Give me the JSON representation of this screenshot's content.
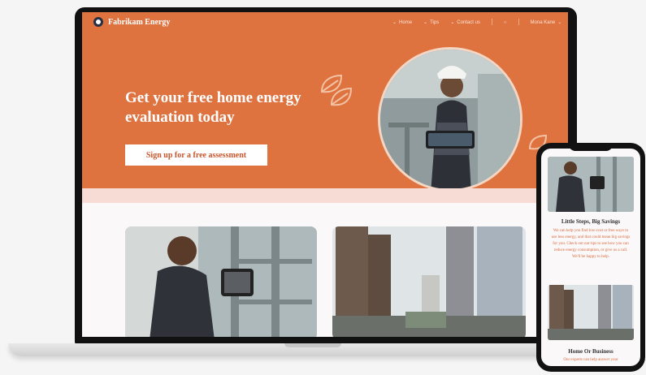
{
  "brand": {
    "name": "Fabrikam Energy"
  },
  "nav": {
    "links": [
      "Home",
      "Tips",
      "Contact us"
    ],
    "account": "Mona Kane"
  },
  "hero": {
    "title": "Get your free home energy evaluation today",
    "cta": "Sign up for a free assessment"
  },
  "mobile": {
    "card1_title": "Little Steps, Big Savings",
    "card1_body": "We can help you find low-cost or free ways to use less energy, and that could mean big savings for you. Check out our tips to see how you can reduce energy consumption, or give us a call. We'll be happy to help.",
    "card2_title": "Home Or Business",
    "card2_body": "Our experts can help answer your"
  },
  "colors": {
    "accent": "#de7340",
    "band": "#f6dcd5"
  },
  "icons": [
    "leaf-icon",
    "chevron-down-icon",
    "account-icon"
  ]
}
